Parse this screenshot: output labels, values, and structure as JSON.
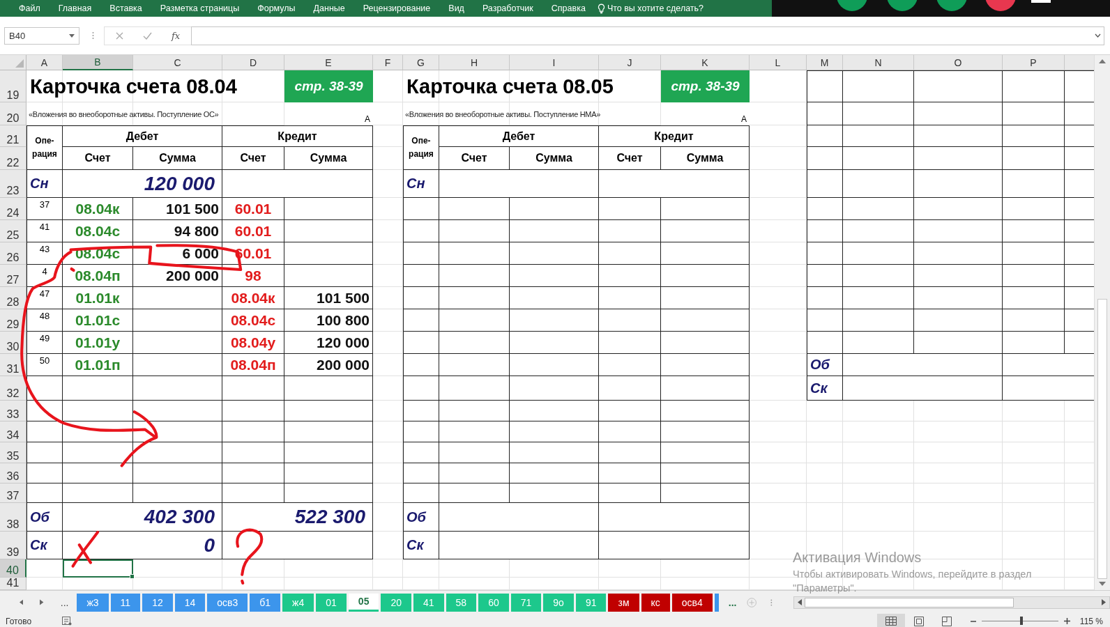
{
  "menu": {
    "items": [
      "Файл",
      "Главная",
      "Вставка",
      "Разметка страницы",
      "Формулы",
      "Данные",
      "Рецензирование",
      "Вид",
      "Разработчик",
      "Справка"
    ],
    "tell_me": "Что вы хотите сделать?"
  },
  "formula_bar": {
    "name_box": "B40",
    "fx": "fx"
  },
  "column_headers": [
    {
      "label": "A",
      "selected": false
    },
    {
      "label": "B",
      "selected": true
    },
    {
      "label": "C",
      "selected": false
    },
    {
      "label": "D",
      "selected": false
    },
    {
      "label": "E",
      "selected": false
    },
    {
      "label": "F",
      "selected": false
    },
    {
      "label": "G",
      "selected": false
    },
    {
      "label": "H",
      "selected": false
    },
    {
      "label": "I",
      "selected": false
    },
    {
      "label": "J",
      "selected": false
    },
    {
      "label": "K",
      "selected": false
    },
    {
      "label": "L",
      "selected": false
    },
    {
      "label": "M",
      "selected": false
    },
    {
      "label": "N",
      "selected": false
    },
    {
      "label": "O",
      "selected": false
    },
    {
      "label": "P",
      "selected": false
    }
  ],
  "row_headers": [
    {
      "label": "19",
      "selected": false
    },
    {
      "label": "20",
      "selected": false
    },
    {
      "label": "21",
      "selected": false
    },
    {
      "label": "22",
      "selected": false
    },
    {
      "label": "23",
      "selected": false
    },
    {
      "label": "24",
      "selected": false
    },
    {
      "label": "25",
      "selected": false
    },
    {
      "label": "26",
      "selected": false
    },
    {
      "label": "27",
      "selected": false
    },
    {
      "label": "28",
      "selected": false
    },
    {
      "label": "29",
      "selected": false
    },
    {
      "label": "30",
      "selected": false
    },
    {
      "label": "31",
      "selected": false
    },
    {
      "label": "32",
      "selected": false
    },
    {
      "label": "33",
      "selected": false
    },
    {
      "label": "34",
      "selected": false
    },
    {
      "label": "35",
      "selected": false
    },
    {
      "label": "36",
      "selected": false
    },
    {
      "label": "37",
      "selected": false
    },
    {
      "label": "38",
      "selected": false
    },
    {
      "label": "39",
      "selected": false
    },
    {
      "label": "40",
      "selected": true
    },
    {
      "label": "41",
      "selected": false
    }
  ],
  "cards": [
    {
      "title": "Карточка счета 08.04",
      "page_badge": "стр. 38-39",
      "subtitle": "«Вложения во внеоборотные активы. Поступление ОС»",
      "corner_mark": "А",
      "op_header": "Опе-\nрация",
      "debit_header": "Дебет",
      "credit_header": "Кредит",
      "sub_headers": [
        "Счет",
        "Сумма",
        "Счет",
        "Сумма"
      ],
      "opening_label": "Сн",
      "opening_debit": "120 000",
      "entries": [
        {
          "op": "37",
          "debit_account": "08.04к",
          "debit_amount": "101 500",
          "credit_account": "60.01"
        },
        {
          "op": "41",
          "debit_account": "08.04с",
          "debit_amount": "94 800",
          "credit_account": "60.01"
        },
        {
          "op": "43",
          "debit_account": "08.04с",
          "debit_amount": "6 000",
          "credit_account": "60.01"
        },
        {
          "op": "4",
          "debit_account": "08.04п",
          "debit_amount": "200 000",
          "credit_account": "98"
        },
        {
          "op": "47",
          "debit_account": "01.01к",
          "credit_account": "08.04к",
          "credit_amount": "101 500"
        },
        {
          "op": "48",
          "debit_account": "01.01с",
          "credit_account": "08.04с",
          "credit_amount": "100 800"
        },
        {
          "op": "49",
          "debit_account": "01.01у",
          "credit_account": "08.04у",
          "credit_amount": "120 000"
        },
        {
          "op": "50",
          "debit_account": "01.01п",
          "credit_account": "08.04п",
          "credit_amount": "200 000"
        }
      ],
      "turnover_label": "Об",
      "turnover_debit": "402 300",
      "turnover_credit": "522 300",
      "closing_label": "Ск",
      "closing_debit": "0"
    },
    {
      "title": "Карточка счета 08.05",
      "page_badge": "стр. 38-39",
      "subtitle": "«Вложения во внеоборотные активы. Поступление НМА»",
      "corner_mark": "А",
      "op_header": "Опе-\nрация",
      "debit_header": "Дебет",
      "credit_header": "Кредит",
      "sub_headers": [
        "Счет",
        "Сумма",
        "Счет",
        "Сумма"
      ],
      "opening_label": "Сн",
      "turnover_label": "Об",
      "closing_label": "Ск"
    }
  ],
  "summary_block": {
    "turnover_label": "Об",
    "closing_label": "Ск"
  },
  "annotations": [
    {
      "kind": "circle"
    },
    {
      "kind": "arrow"
    },
    {
      "kind": "cross"
    },
    {
      "kind": "question"
    },
    {
      "kind": "dot"
    }
  ],
  "activation_notice": {
    "title": "Активация Windows",
    "lines": [
      "Чтобы активировать Windows, перейдите в раздел",
      "\"Параметры\"."
    ]
  },
  "sheet_nav": {
    "more_left": "...",
    "more_right": "..."
  },
  "sheet_tabs": [
    {
      "label": "ж3",
      "color": "#3c95ec",
      "selected": false
    },
    {
      "label": "11",
      "color": "#3c95ec",
      "selected": false
    },
    {
      "label": "12",
      "color": "#3c95ec",
      "selected": false
    },
    {
      "label": "14",
      "color": "#3c95ec",
      "selected": false
    },
    {
      "label": "осв3",
      "color": "#3c95ec",
      "selected": false
    },
    {
      "label": "б1",
      "color": "#3c95ec",
      "selected": false
    },
    {
      "label": "ж4",
      "color": "#1dc88c",
      "selected": false
    },
    {
      "label": "01",
      "color": "#1dc88c",
      "selected": false
    },
    {
      "label": "05",
      "color": "#1dc88c",
      "selected": true
    },
    {
      "label": "20",
      "color": "#1dc88c",
      "selected": false
    },
    {
      "label": "41",
      "color": "#1dc88c",
      "selected": false
    },
    {
      "label": "58",
      "color": "#1dc88c",
      "selected": false
    },
    {
      "label": "60",
      "color": "#1dc88c",
      "selected": false
    },
    {
      "label": "71",
      "color": "#1dc88c",
      "selected": false
    },
    {
      "label": "9о",
      "color": "#1dc88c",
      "selected": false
    },
    {
      "label": "91",
      "color": "#1dc88c",
      "selected": false
    },
    {
      "label": "зм",
      "color": "#c00000",
      "selected": false
    },
    {
      "label": "кс",
      "color": "#c00000",
      "selected": false
    },
    {
      "label": "осв4",
      "color": "#c00000",
      "selected": false
    },
    {
      "color": "#3c95ec",
      "selected": false
    }
  ],
  "status_bar": {
    "text": "Готово",
    "zoom": {
      "label": "115 %",
      "level": 0.52
    }
  }
}
